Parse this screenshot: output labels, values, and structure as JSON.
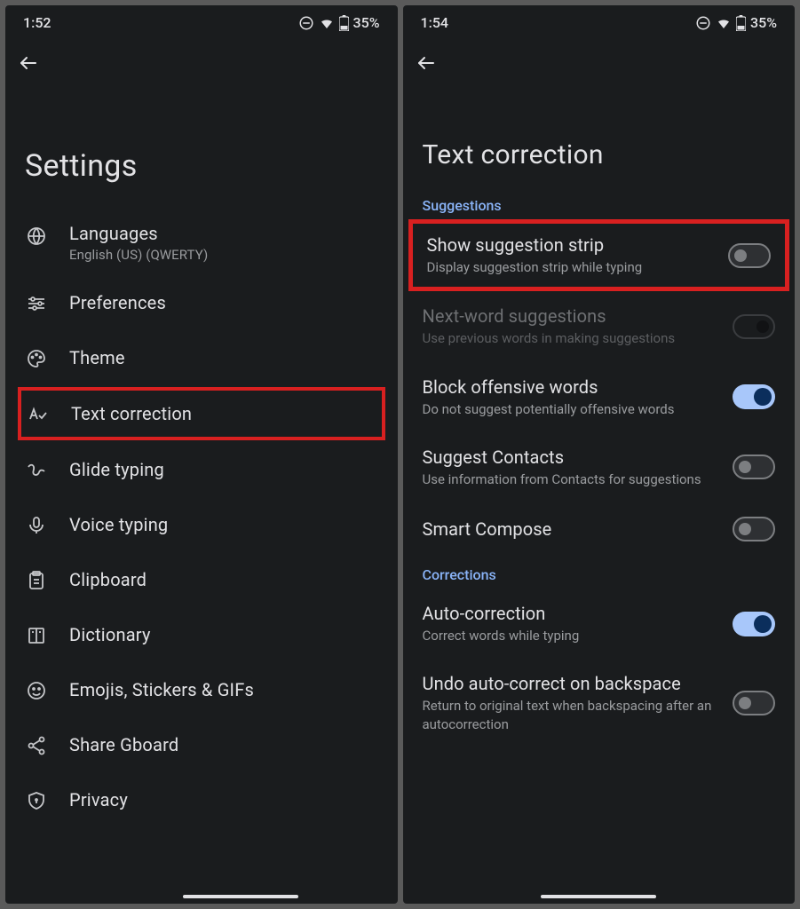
{
  "left": {
    "status": {
      "time": "1:52",
      "battery": "35%"
    },
    "title": "Settings",
    "items": [
      {
        "title": "Languages",
        "subtitle": "English (US) (QWERTY)"
      },
      {
        "title": "Preferences"
      },
      {
        "title": "Theme"
      },
      {
        "title": "Text correction",
        "highlighted": true
      },
      {
        "title": "Glide typing"
      },
      {
        "title": "Voice typing"
      },
      {
        "title": "Clipboard"
      },
      {
        "title": "Dictionary"
      },
      {
        "title": "Emojis, Stickers & GIFs"
      },
      {
        "title": "Share Gboard"
      },
      {
        "title": "Privacy"
      }
    ]
  },
  "right": {
    "status": {
      "time": "1:54",
      "battery": "35%"
    },
    "title": "Text correction",
    "sections": {
      "suggestions": "Suggestions",
      "corrections": "Corrections"
    },
    "settings": [
      {
        "title": "Show suggestion strip",
        "subtitle": "Display suggestion strip while typing",
        "toggle": "off",
        "highlighted": true
      },
      {
        "title": "Next-word suggestions",
        "subtitle": "Use previous words in making suggestions",
        "toggle": "disabled-off",
        "disabled": true
      },
      {
        "title": "Block offensive words",
        "subtitle": "Do not suggest potentially offensive words",
        "toggle": "on"
      },
      {
        "title": "Suggest Contacts",
        "subtitle": "Use information from Contacts for suggestions",
        "toggle": "off"
      },
      {
        "title": "Smart Compose",
        "subtitle": "",
        "toggle": "off"
      },
      {
        "title": "Auto-correction",
        "subtitle": "Correct words while typing",
        "toggle": "on"
      },
      {
        "title": "Undo auto-correct on backspace",
        "subtitle": "Return to original text when backspacing after an autocorrection",
        "toggle": "off"
      }
    ]
  }
}
